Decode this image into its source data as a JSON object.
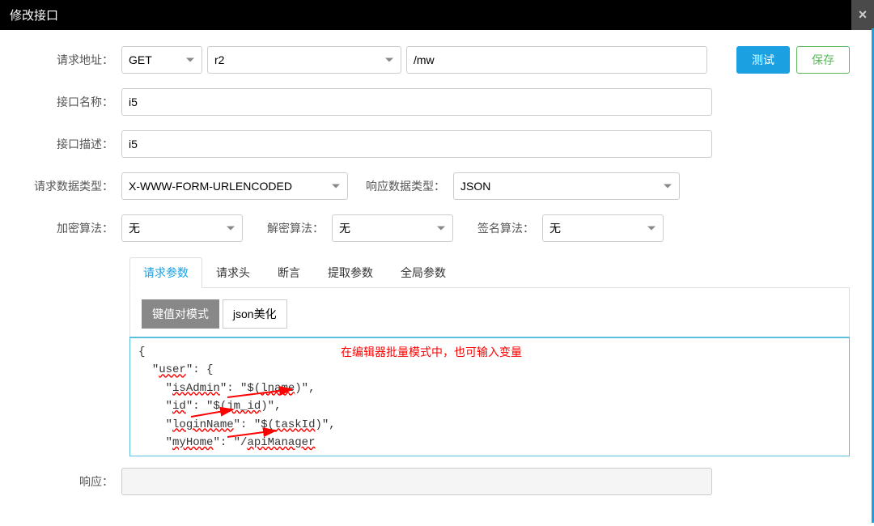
{
  "dialog": {
    "title": "修改接口"
  },
  "labels": {
    "request_url": "请求地址：",
    "interface_name": "接口名称：",
    "interface_desc": "接口描述：",
    "request_data_type": "请求数据类型：",
    "response_data_type": "响应数据类型：",
    "encrypt_algo": "加密算法：",
    "decrypt_algo": "解密算法：",
    "sign_algo": "签名算法：",
    "response": "响应："
  },
  "fields": {
    "method": "GET",
    "host": "r2",
    "path": "/mw",
    "name": "i5",
    "desc": "i5",
    "request_data_type": "X-WWW-FORM-URLENCODED",
    "response_data_type": "JSON",
    "encrypt_algo": "无",
    "decrypt_algo": "无",
    "sign_algo": "无",
    "response_value": ""
  },
  "buttons": {
    "test": "测试",
    "save": "保存"
  },
  "tabs": {
    "request_params": "请求参数",
    "request_headers": "请求头",
    "assertions": "断言",
    "extract_params": "提取参数",
    "global_params": "全局参数"
  },
  "modes": {
    "keyvalue": "键值对模式",
    "json_beautify": "json美化"
  },
  "editor": {
    "line1": "{",
    "line2_indent": "  ",
    "line2_q1": "\"",
    "line2_user": "user",
    "line2_rest": "\": {",
    "line3_indent": "    \"",
    "line3_isadmin": "isAdmin",
    "line3_mid": "\": \"$(",
    "line3_lname": "lname",
    "line3_end": ")\",",
    "line4_indent": "    \"",
    "line4_id": "id",
    "line4_mid": "\": \"$(",
    "line4_jm": "jm_id",
    "line4_end": ")\",",
    "line5_indent": "    \"",
    "line5_login": "loginName",
    "line5_mid": "\": \"$(",
    "line5_taskid": "taskId",
    "line5_end": ")\",",
    "line6_indent": "    \"",
    "line6_myhome": "myHome",
    "line6_mid": "\": \"/",
    "line6_apimanager": "apiManager"
  },
  "annotation": {
    "text": "在编辑器批量模式中，也可输入变量"
  }
}
